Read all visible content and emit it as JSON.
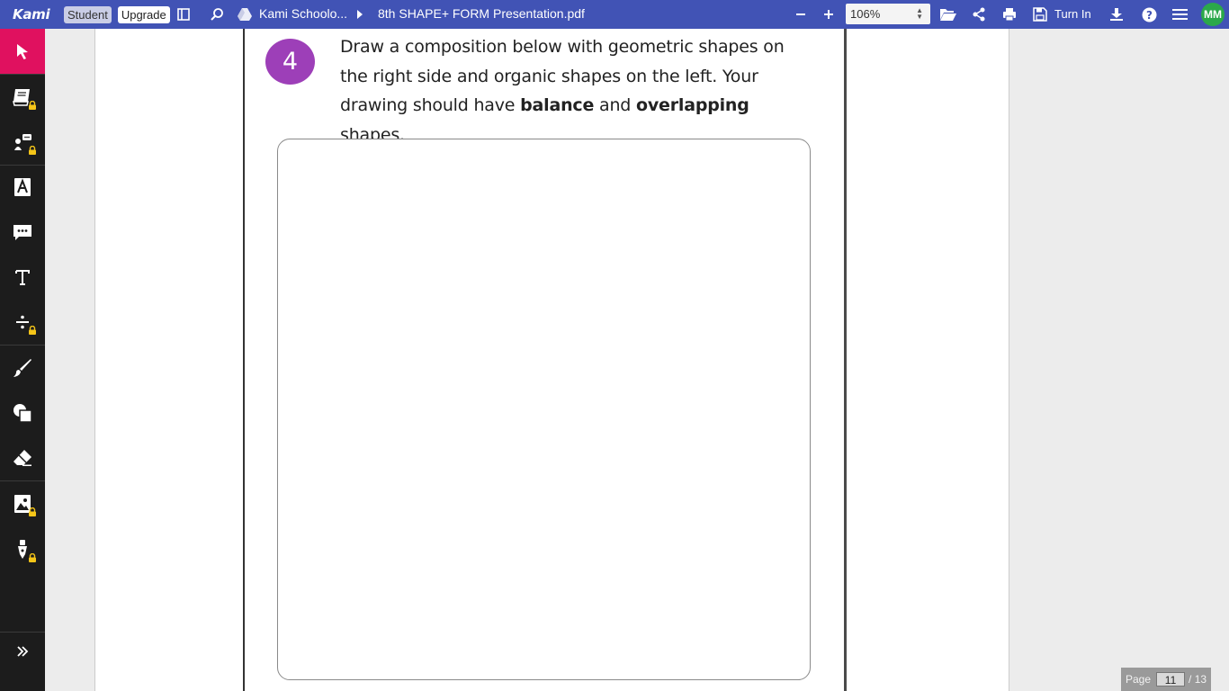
{
  "app": {
    "logo": "Kami",
    "student_label": "Student",
    "upgrade_label": "Upgrade"
  },
  "breadcrumb": {
    "drive": "Kami Schoolo...",
    "file": "8th SHAPE+ FORM Presentation.pdf"
  },
  "toolbar": {
    "zoom": "106%",
    "turn_in": "Turn In",
    "avatar": "MM"
  },
  "sidebar": {
    "tools": [
      {
        "name": "select-tool",
        "icon": "cursor-icon",
        "locked": false,
        "active": true
      },
      {
        "name": "dictionary-tool",
        "icon": "book-icon",
        "locked": true
      },
      {
        "name": "text-to-speech-tool",
        "icon": "speech-icon",
        "locked": true
      },
      {
        "name": "markup-tool",
        "icon": "highlight-icon",
        "locked": false
      },
      {
        "name": "comment-tool",
        "icon": "comment-icon",
        "locked": false
      },
      {
        "name": "text-tool",
        "icon": "text-icon",
        "locked": false
      },
      {
        "name": "equation-tool",
        "icon": "divide-icon",
        "locked": true
      },
      {
        "name": "drawing-tool",
        "icon": "brush-icon",
        "locked": false
      },
      {
        "name": "shapes-tool",
        "icon": "shapes-icon",
        "locked": false
      },
      {
        "name": "eraser-tool",
        "icon": "eraser-icon",
        "locked": false
      },
      {
        "name": "image-tool",
        "icon": "image-icon",
        "locked": true
      },
      {
        "name": "signature-tool",
        "icon": "pen-icon",
        "locked": true
      }
    ]
  },
  "document": {
    "step_number": "4",
    "line1": "Draw a composition below with geometric shapes on",
    "line2": "the right side and organic shapes on the left. Your",
    "line3_pre": "drawing should have ",
    "line3_b1": "balance",
    "line3_mid": " and ",
    "line3_b2": "overlapping",
    "line3_post": " shapes."
  },
  "pager": {
    "label": "Page",
    "current": "11",
    "total": "/ 13"
  },
  "colors": {
    "topbar": "#4153b5",
    "sidebar": "#1c1c1c",
    "active_tool": "#e0115f",
    "step_circle": "#9d3fb8",
    "avatar": "#2ba84a"
  }
}
